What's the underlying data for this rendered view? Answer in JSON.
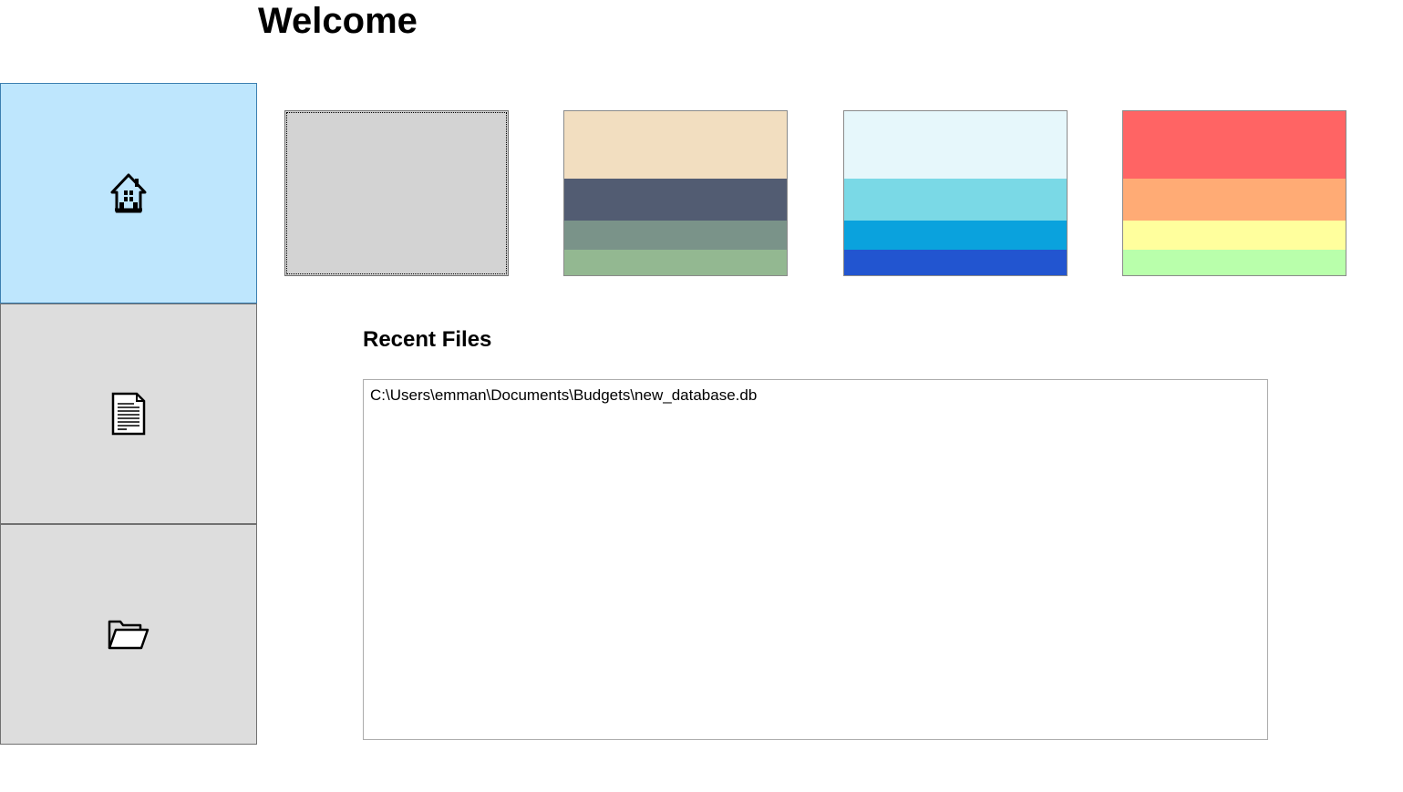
{
  "header": {
    "title": "Welcome"
  },
  "sidebar": {
    "items": [
      {
        "icon": "home-icon",
        "active": true
      },
      {
        "icon": "document-icon",
        "active": false
      },
      {
        "icon": "folder-open-icon",
        "active": false
      }
    ],
    "active_color": "#bee6fd",
    "inactive_color": "#dddddd"
  },
  "themes": [
    {
      "name": "gray",
      "selected": true,
      "colors": [
        "#d3d3d3"
      ]
    },
    {
      "name": "earth",
      "selected": false,
      "colors": [
        "#f2dec0",
        "#525c72",
        "#7a9389",
        "#93b891"
      ]
    },
    {
      "name": "ocean",
      "selected": false,
      "colors": [
        "#e6f7fb",
        "#7ad9e6",
        "#0aa2dd",
        "#2255d0"
      ]
    },
    {
      "name": "warm",
      "selected": false,
      "colors": [
        "#ff6464",
        "#ffab75",
        "#ffff9d",
        "#b9ffab"
      ]
    }
  ],
  "recent": {
    "heading": "Recent Files",
    "files": [
      "C:\\Users\\emman\\Documents\\Budgets\\new_database.db"
    ]
  }
}
